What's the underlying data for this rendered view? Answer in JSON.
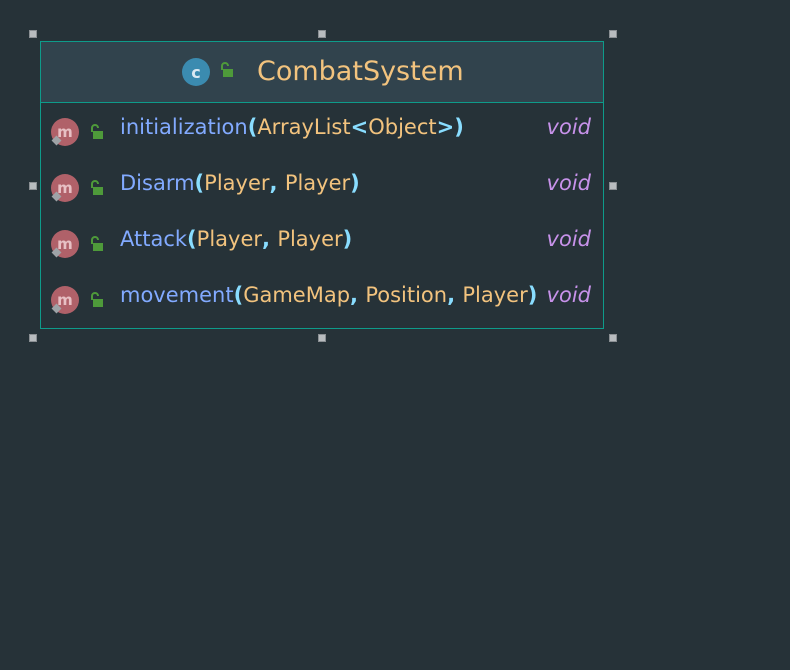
{
  "class": {
    "icon_letter": "c",
    "name": "CombatSystem",
    "class_icon": "class-icon",
    "visibility_icon": "unlock-icon",
    "colors": {
      "class_icon": "#3b8bb0",
      "method_icon": "#b06169",
      "visibility": "#4e9a3a",
      "border": "#0e9b8a",
      "name": "#f2c37e",
      "method_name": "#82aaff",
      "param_type": "#f2c37e",
      "paren": "#89ddff",
      "return_type": "#c792ea"
    },
    "methods": [
      {
        "icon_letter": "m",
        "name": "initialization",
        "open": "(",
        "params": [
          "ArrayList",
          "<",
          "Object",
          ">"
        ],
        "close": ")",
        "return": "void"
      },
      {
        "icon_letter": "m",
        "name": "Disarm",
        "open": "(",
        "params": [
          "Player",
          ", ",
          "Player"
        ],
        "close": ")",
        "return": "void"
      },
      {
        "icon_letter": "m",
        "name": "Attack",
        "open": "(",
        "params": [
          "Player",
          ", ",
          "Player"
        ],
        "close": ")",
        "return": "void"
      },
      {
        "icon_letter": "m",
        "name": "movement",
        "open": "(",
        "params": [
          "GameMap",
          ", ",
          "Position",
          ", ",
          "Player"
        ],
        "close": ")",
        "return": "void"
      }
    ]
  }
}
